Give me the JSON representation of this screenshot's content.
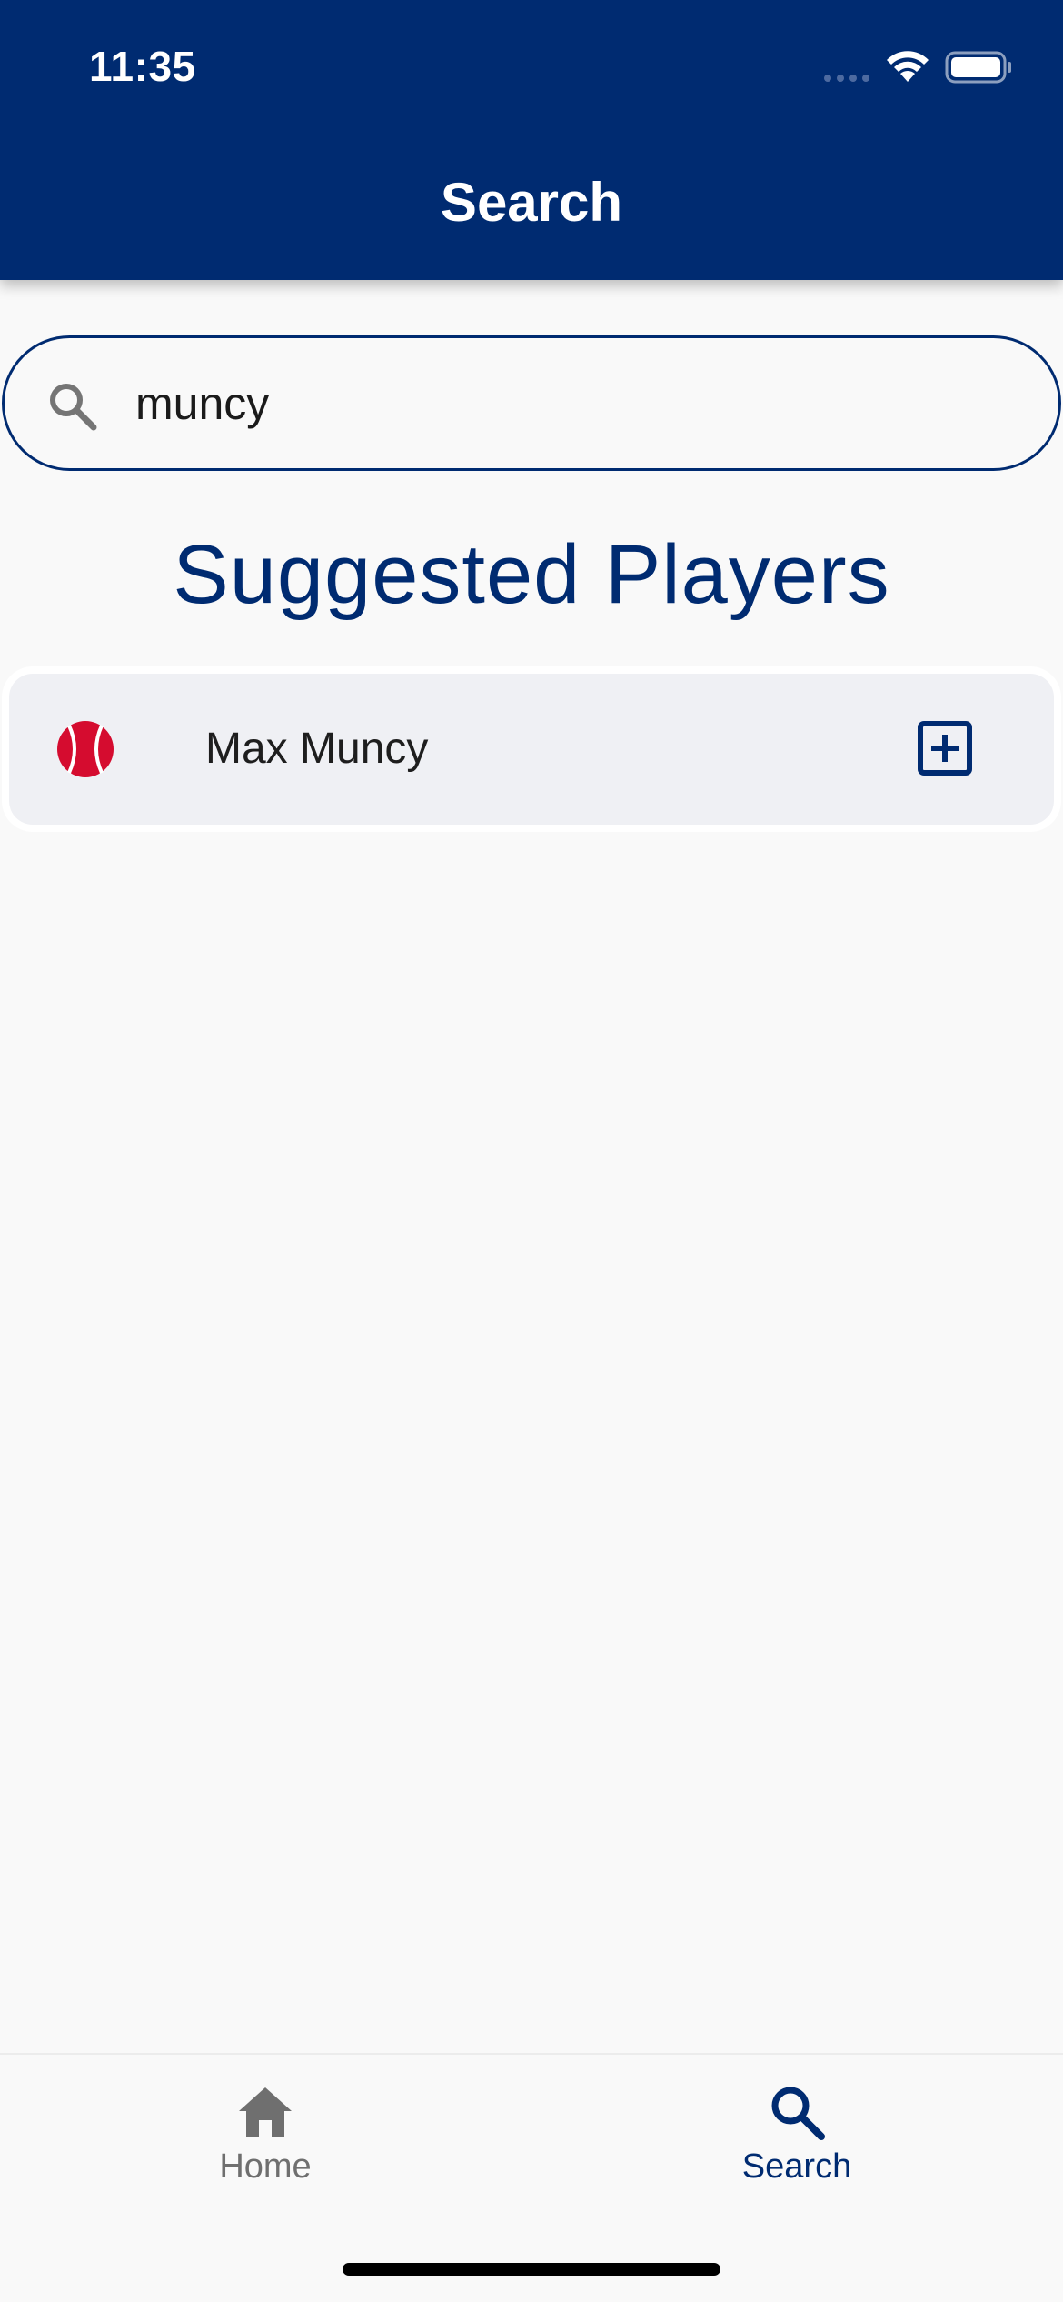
{
  "status_bar": {
    "time": "11:35"
  },
  "header": {
    "title": "Search"
  },
  "search": {
    "value": "muncy",
    "icon": "search-icon"
  },
  "section": {
    "title": "Suggested Players"
  },
  "results": [
    {
      "name": "Max Muncy",
      "icon": "baseball-icon",
      "action_icon": "add-box-icon"
    }
  ],
  "bottom_nav": {
    "items": [
      {
        "label": "Home",
        "icon": "home-icon",
        "active": false
      },
      {
        "label": "Search",
        "icon": "search-icon",
        "active": true
      }
    ]
  },
  "colors": {
    "primary": "#002b71",
    "accent_red": "#d50c2f",
    "background": "#f9f9f9",
    "card": "#eff0f4",
    "inactive": "#6f6f6f"
  }
}
